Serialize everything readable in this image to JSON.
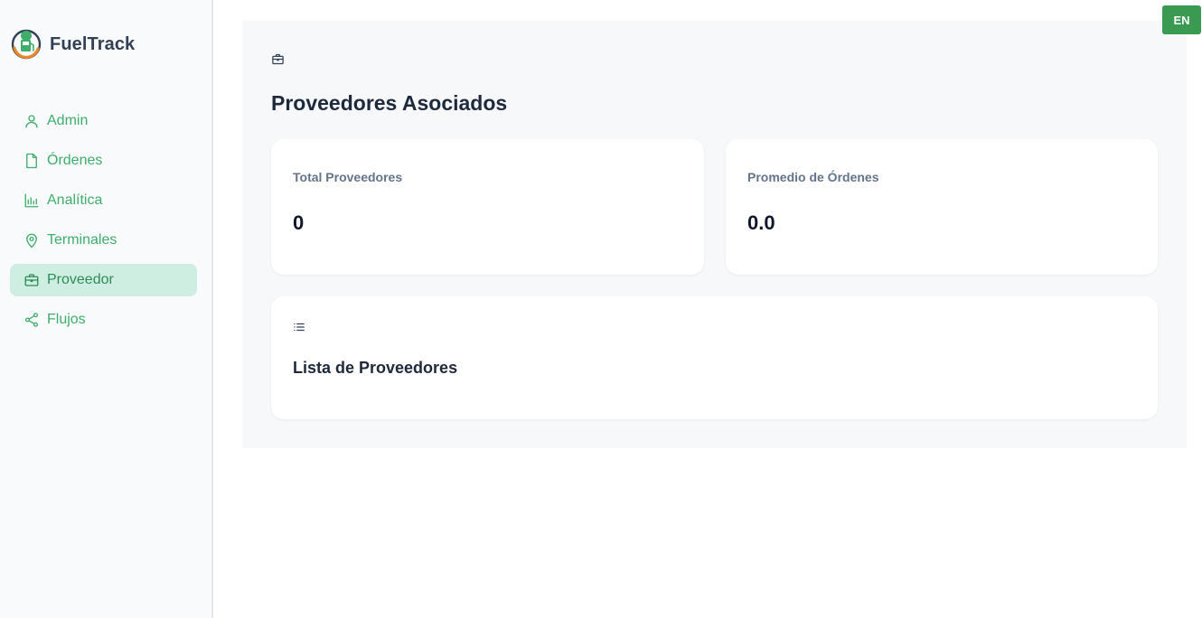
{
  "app": {
    "name": "FuelTrack"
  },
  "sidebar": {
    "items": [
      {
        "label": "Admin",
        "icon": "user-icon",
        "active": false
      },
      {
        "label": "Órdenes",
        "icon": "file-icon",
        "active": false
      },
      {
        "label": "Analítica",
        "icon": "bar-chart-icon",
        "active": false
      },
      {
        "label": "Terminales",
        "icon": "map-pin-icon",
        "active": false
      },
      {
        "label": "Proveedor",
        "icon": "briefcase-icon",
        "active": true
      },
      {
        "label": "Flujos",
        "icon": "share-icon",
        "active": false
      }
    ]
  },
  "header": {
    "language_button": "EN"
  },
  "main": {
    "section_icon": "briefcase-icon",
    "title": "Proveedores Asociados",
    "stats": [
      {
        "label": "Total Proveedores",
        "value": "0"
      },
      {
        "label": "Promedio de Órdenes",
        "value": "0.0"
      }
    ],
    "list": {
      "icon": "list-icon",
      "title": "Lista de Proveedores"
    }
  },
  "colors": {
    "accent": "#3fae6b",
    "active_bg": "#cdeee0",
    "button_green": "#3a9a52",
    "title_text": "#1e293b"
  }
}
